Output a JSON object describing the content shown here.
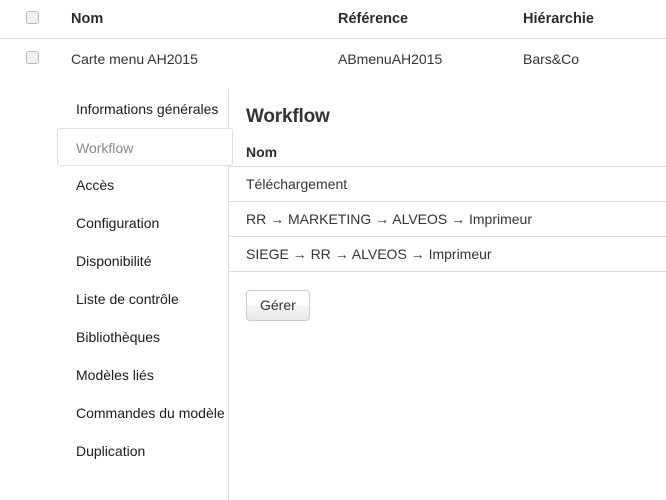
{
  "object_table": {
    "columns": [
      "",
      "Nom",
      "Référence",
      "Hiérarchie"
    ],
    "header_checkbox_name": "select-all-checkbox",
    "rows": [
      {
        "nom": "Carte menu AH2015",
        "reference": "ABmenuAH2015",
        "hierarchie": "Bars&Co"
      }
    ]
  },
  "sidebar": {
    "items": [
      {
        "label": "Informations générales",
        "active": false
      },
      {
        "label": "Workflow",
        "active": true
      },
      {
        "label": "Accès",
        "active": false
      },
      {
        "label": "Configuration",
        "active": false
      },
      {
        "label": "Disponibilité",
        "active": false
      },
      {
        "label": "Liste de contrôle",
        "active": false
      },
      {
        "label": "Bibliothèques",
        "active": false
      },
      {
        "label": "Modèles liés",
        "active": false
      },
      {
        "label": "Commandes du modèle",
        "active": false
      },
      {
        "label": "Duplication",
        "active": false
      }
    ]
  },
  "main": {
    "title": "Workflow",
    "table": {
      "columns": [
        "Nom"
      ],
      "rows": [
        {
          "nom": "Téléchargement"
        },
        {
          "nom": "RR → MARKETING → ALVEOS → Imprimeur"
        },
        {
          "nom": "SIEGE → RR → ALVEOS → Imprimeur"
        }
      ]
    },
    "manage_button_label": "Gérer"
  },
  "colors": {
    "text": "#333333",
    "heading": "#2b2b2b",
    "divider": "#dddddd",
    "border": "#dedede",
    "active_text": "#888888",
    "background": "#ffffff"
  }
}
